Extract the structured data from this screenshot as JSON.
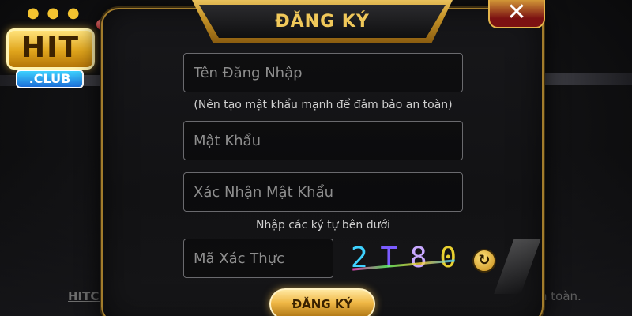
{
  "background": {
    "left_text": "HITCL",
    "right_text": "n toàn."
  },
  "logo": {
    "main_text": "HIT",
    "sub_text": ".CLUB"
  },
  "dialog": {
    "title": "ĐĂNG KÝ",
    "close_icon": "close-x-icon",
    "username_placeholder": "Tên Đăng Nhập",
    "password_hint": "(Nên tạo mật khẩu mạnh để đảm bảo an toàn)",
    "password_placeholder": "Mật Khẩu",
    "confirm_placeholder": "Xác Nhận Mật Khẩu",
    "captcha_hint": "Nhập các ký tự bên dưới",
    "captcha_placeholder": "Mã Xác Thực",
    "captcha_chars": [
      "2",
      "T",
      "8",
      "0"
    ],
    "captcha_colors": [
      "#3fd2ff",
      "#7b5cff",
      "#c8a8ff",
      "#e8d030"
    ],
    "refresh_icon": "refresh-icon",
    "submit_label": "ĐĂNG KÝ"
  },
  "colors": {
    "accent_gold": "#f0c85a",
    "close_red": "#7c1212"
  }
}
